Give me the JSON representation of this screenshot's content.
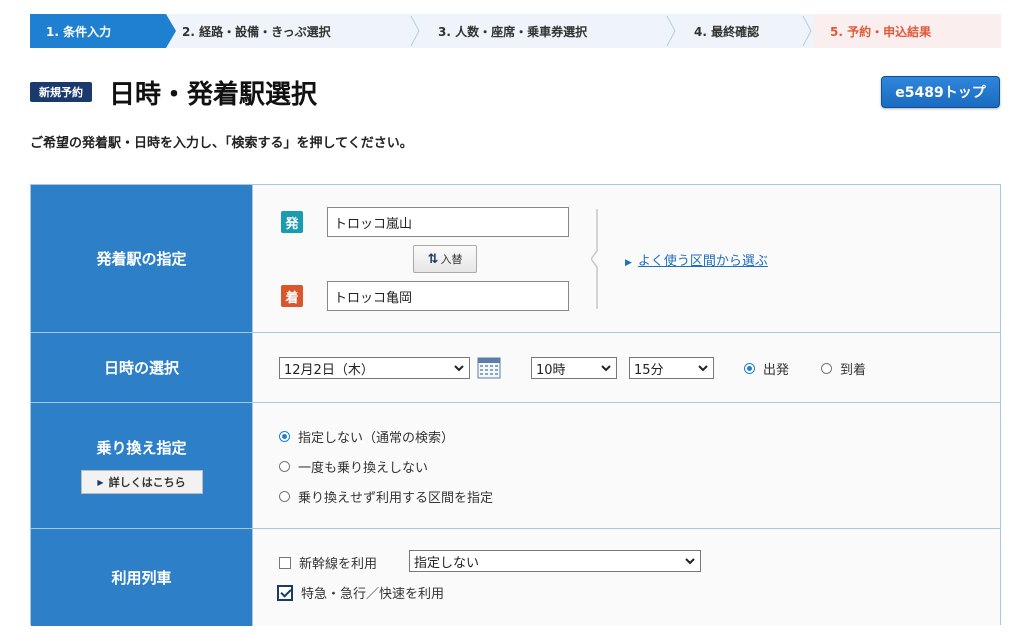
{
  "steps": [
    {
      "label": "1. 条件入力"
    },
    {
      "label": "2. 経路・設備・きっぷ選択"
    },
    {
      "label": "3. 人数・座席・乗車券選択"
    },
    {
      "label": "4. 最終確認"
    },
    {
      "label": "5. 予約・申込結果"
    }
  ],
  "header": {
    "badge": "新規予約",
    "title": "日時・発着駅選択",
    "top_button": "e5489トップ"
  },
  "instruction": "ご希望の発着駅・日時を入力し、「検索する」を押してください。",
  "stations": {
    "label": "発着駅の指定",
    "departure_badge": "発",
    "departure_value": "トロッコ嵐山",
    "swap_label": "入替",
    "arrival_badge": "着",
    "arrival_value": "トロッコ亀岡",
    "favorite_link": "よく使う区間から選ぶ"
  },
  "datetime": {
    "label": "日時の選択",
    "date": "12月2日（木）",
    "hour": "10時",
    "minute": "15分",
    "depart_label": "出発",
    "arrive_label": "到着",
    "selected": "depart"
  },
  "transfer": {
    "label": "乗り換え指定",
    "detail_button": "詳しくはこちら",
    "options": [
      "指定しない（通常の検索）",
      "一度も乗り換えしない",
      "乗り換えせず利用する区間を指定"
    ],
    "selected_index": 0
  },
  "trains": {
    "label": "利用列車",
    "shinkansen_label": "新幹線を利用",
    "shinkansen_checked": false,
    "shinkansen_select": "指定しない",
    "express_label": "特急・急行／快速を利用",
    "express_checked": true
  },
  "colors": {
    "primary": "#2d80c8",
    "step_active": "#1f7fd0",
    "step_final": "#e05a3a",
    "navy": "#1a3a6e",
    "departure_badge": "#1b9bb0",
    "arrival_badge": "#d9572b"
  }
}
